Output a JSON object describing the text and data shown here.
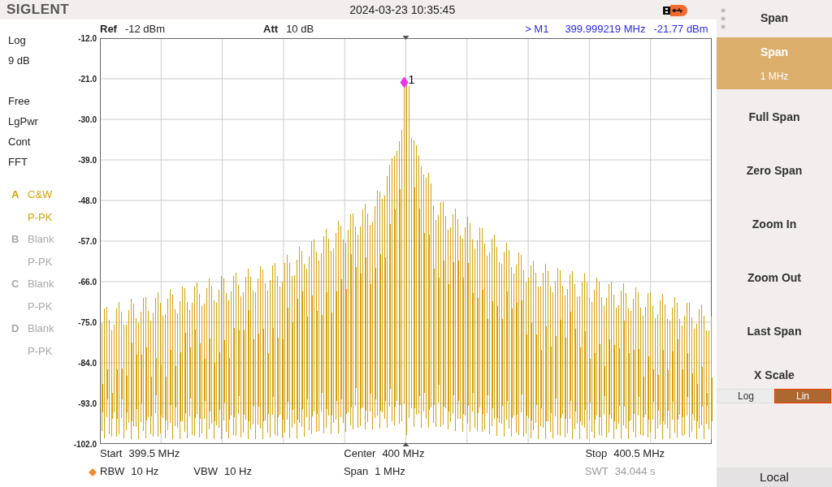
{
  "header": {
    "brand": "SIGLENT",
    "datetime": "2024-03-23 10:35:45"
  },
  "plot_header": {
    "ref_label": "Ref",
    "ref_value": "-12 dBm",
    "att_label": "Att",
    "att_value": "10 dB",
    "marker_readout": "> M1",
    "marker_freq": "399.999219 MHz",
    "marker_level": "-21.77 dBm"
  },
  "left_info": [
    [
      "Log",
      "9 dB"
    ],
    [
      "Free",
      "LgPwr",
      "Cont",
      "FFT"
    ]
  ],
  "traces": [
    {
      "letter": "A",
      "mode": "C&W",
      "detector": "P-PK",
      "active": true
    },
    {
      "letter": "B",
      "mode": "Blank",
      "detector": "P-PK",
      "active": false
    },
    {
      "letter": "C",
      "mode": "Blank",
      "detector": "P-PK",
      "active": false
    },
    {
      "letter": "D",
      "mode": "Blank",
      "detector": "P-PK",
      "active": false
    }
  ],
  "y_labels": [
    "-12.0",
    "-21.0",
    "-30.0",
    "-39.0",
    "-48.0",
    "-57.0",
    "-66.0",
    "-75.0",
    "-84.0",
    "-93.0",
    "-102.0"
  ],
  "marker": {
    "label": "1"
  },
  "footer": [
    [
      {
        "label": "Start",
        "value": "399.5 MHz",
        "muted": false
      },
      {
        "label": "Center",
        "value": "400 MHz",
        "muted": false
      },
      {
        "label": "Stop",
        "value": "400.5 MHz",
        "muted": false
      }
    ],
    [
      {
        "label": "RBW",
        "value": "10 Hz",
        "muted": false,
        "flag": true
      },
      {
        "label": "VBW",
        "value": "10 Hz",
        "muted": false
      },
      {
        "label": "Span",
        "value": "1 MHz",
        "muted": false
      },
      {
        "label": "SWT",
        "value": "34.044 s",
        "muted": true
      }
    ]
  ],
  "menu": {
    "title": "Span",
    "items": [
      {
        "kind": "value",
        "label": "Span",
        "value": "1 MHz",
        "selected": true
      },
      {
        "kind": "plain",
        "label": "Full Span",
        "selected": false
      },
      {
        "kind": "plain",
        "label": "Zero Span",
        "selected": false
      },
      {
        "kind": "plain",
        "label": "Zoom In",
        "selected": false
      },
      {
        "kind": "plain",
        "label": "Zoom Out",
        "selected": false
      },
      {
        "kind": "plain",
        "label": "Last Span",
        "selected": false
      },
      {
        "kind": "toggle",
        "label": "X Scale",
        "options": [
          {
            "label": "Log",
            "selected": false
          },
          {
            "label": "Lin",
            "selected": true
          }
        ]
      }
    ],
    "footer": "Local"
  }
}
